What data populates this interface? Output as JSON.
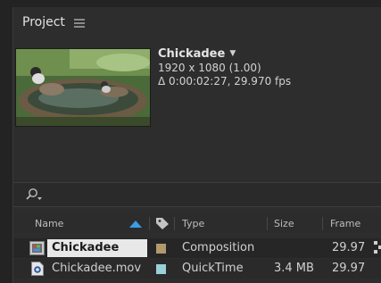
{
  "panel": {
    "title": "Project"
  },
  "preview": {
    "name": "Chickadee",
    "dropdown_icon": "caret-down-icon",
    "dimensions": "1920 x 1080 (1.00)",
    "duration": "Δ 0:00:02:27, 29.970 fps"
  },
  "search": {
    "icon": "search-icon",
    "value": ""
  },
  "columns": {
    "name": "Name",
    "type": "Type",
    "size": "Size",
    "frame_rate": "Frame Ra..."
  },
  "rows": [
    {
      "icon": "composition-icon",
      "name": "Chickadee",
      "label_color": "#b3996e",
      "type": "Composition",
      "size": "",
      "frame_rate": "29.97"
    },
    {
      "icon": "quicktime-file-icon",
      "name": "Chickadee.mov",
      "label_color": "#9ad0d8",
      "type": "QuickTime",
      "size": "3.4 MB",
      "frame_rate": "29.97"
    }
  ],
  "colors": {
    "accent": "#2f8fd8",
    "panel_bg": "#2d2d2d",
    "selection": "#e8e8e8"
  }
}
